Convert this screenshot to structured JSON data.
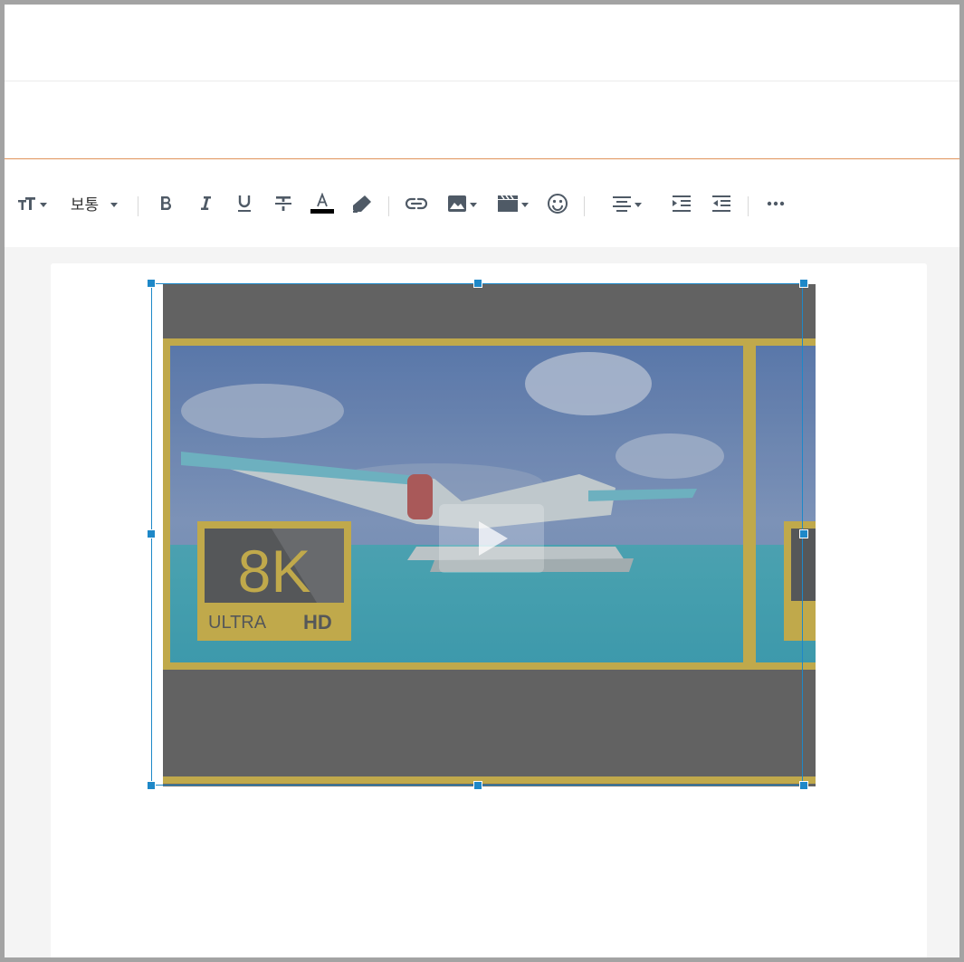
{
  "toolbar": {
    "font_size_label": "보통",
    "icons": [
      "text-size-icon",
      "bold-icon",
      "italic-icon",
      "underline-icon",
      "strikethrough-icon",
      "font-color-icon",
      "highlight-icon",
      "link-icon",
      "image-icon",
      "video-icon",
      "emoji-icon",
      "align-center-icon",
      "indent-icon",
      "outdent-icon",
      "more-icon"
    ],
    "font_color": "#000000"
  },
  "video": {
    "badge_main": "8K",
    "badge_sub_left": "ULTRA",
    "badge_sub_right": "HD"
  },
  "colors": {
    "accent_line": "#e0935a",
    "selection": "#1e88c8",
    "badge_gold": "#c9b04a"
  }
}
